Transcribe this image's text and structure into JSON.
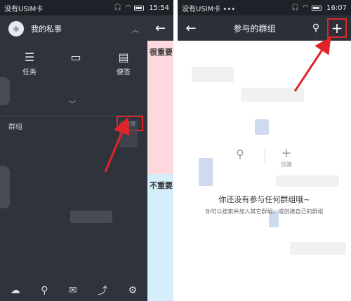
{
  "left_screen": {
    "status": {
      "carrier": "没有USIM卡",
      "time": "15:54"
    },
    "drawer": {
      "title": "我的私事",
      "quick_actions": [
        {
          "label": "任务"
        },
        {
          "label": ""
        },
        {
          "label": "便签"
        }
      ],
      "groups_label": "群组",
      "manage_label": "管理"
    },
    "strip": {
      "important_label": "很重要",
      "unimportant_label": "不重要"
    }
  },
  "right_screen": {
    "status": {
      "carrier": "没有USIM卡 •••",
      "time": "16:07"
    },
    "toolbar": {
      "title": "参与的群组"
    },
    "tools": {
      "create_label": "创建"
    },
    "empty": {
      "title": "你还没有参与任何群组哦~",
      "subtitle": "你可以搜索并加入其它群组，或创建自己的群组"
    }
  },
  "colors": {
    "highlight": "#e0242a",
    "dark_bg": "#2c3039",
    "pink": "#fdd9dd",
    "light_blue": "#d5eefb"
  },
  "icons": [
    "wifi-icon",
    "battery-icon",
    "back-arrow-icon",
    "search-icon",
    "plus-icon",
    "cloud-icon",
    "mail-icon",
    "chart-icon",
    "settings-icon"
  ]
}
